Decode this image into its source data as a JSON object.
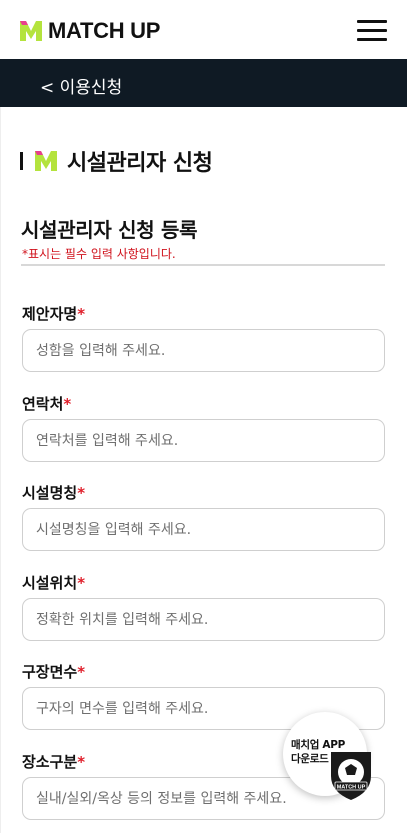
{
  "header": {
    "brand": "MATCH UP",
    "logo_icon": "match-up-logo-icon",
    "menu_icon": "hamburger-menu-icon"
  },
  "subbar": {
    "back_label": "< 이용신청"
  },
  "section": {
    "title": "시설관리자 신청"
  },
  "form": {
    "heading": "시설관리자 신청 등록",
    "required_note": "*표시는 필수 입력 사항입니다.",
    "fields": [
      {
        "label": "제안자명",
        "required_mark": "*",
        "placeholder": "성함을 입력해 주세요."
      },
      {
        "label": "연락처",
        "required_mark": "*",
        "placeholder": "연락처를 입력해 주세요."
      },
      {
        "label": "시설명칭",
        "required_mark": "*",
        "placeholder": "시설명칭을 입력해 주세요."
      },
      {
        "label": "시설위치",
        "required_mark": "*",
        "placeholder": "정확한 위치를 입력해 주세요."
      },
      {
        "label": "구장면수",
        "required_mark": "*",
        "placeholder": "구자의 면수를 입력해 주세요."
      },
      {
        "label": "장소구분",
        "required_mark": "*",
        "placeholder": "실내/실외/옥상 등의 정보를 입력해 주세요."
      }
    ]
  },
  "app_download": {
    "line1": "매치업 APP",
    "line2": "다운로드",
    "shield_text": "MATCH UP"
  },
  "colors": {
    "brand_green": "#b4e33d",
    "brand_pink": "#e83e8c",
    "subbar_bg": "#0f1a24",
    "required_red": "#d0121c"
  }
}
